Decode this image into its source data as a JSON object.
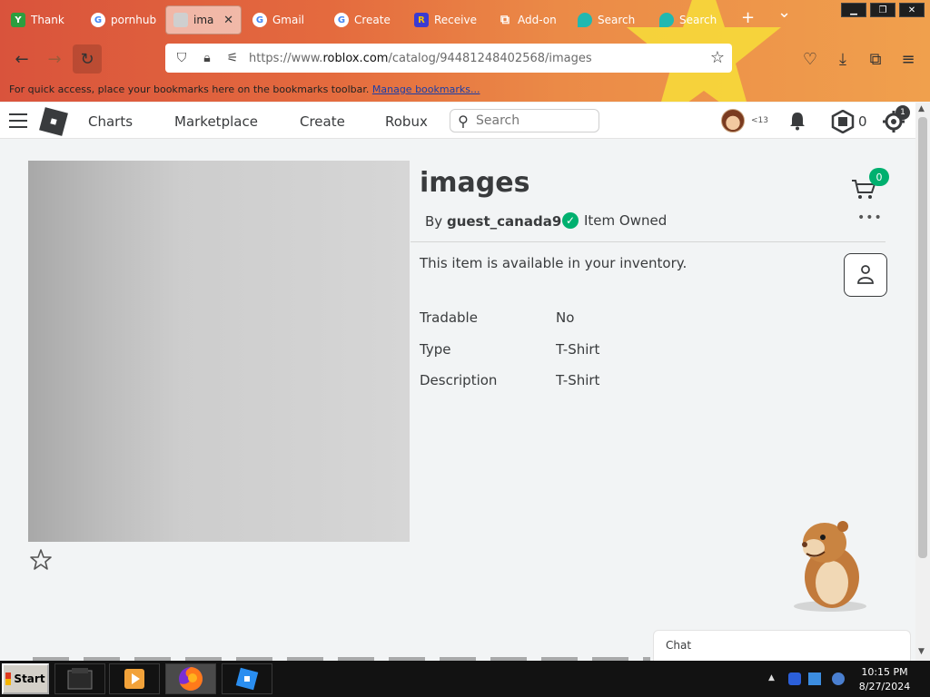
{
  "browser": {
    "tabs": [
      {
        "label": "Thank",
        "favicon": "Y",
        "favicon_color": "#2c9e3f"
      },
      {
        "label": "pornhub",
        "favicon": "G",
        "favicon_color": "#ffffff"
      },
      {
        "label": "image",
        "favicon": "img",
        "favicon_color": "#cccccc",
        "active": true
      },
      {
        "label": "Gmail",
        "favicon": "G",
        "favicon_color": "#ffffff"
      },
      {
        "label": "Create",
        "favicon": "G",
        "favicon_color": "#ffffff"
      },
      {
        "label": "Receive",
        "favicon": "R",
        "favicon_color": "#3b3bd1"
      },
      {
        "label": "Add-on",
        "favicon": "puzzle",
        "favicon_color": "#ffffff"
      },
      {
        "label": "Search",
        "favicon": "shield",
        "favicon_color": "#21b8b0"
      },
      {
        "label": "Search",
        "favicon": "shield",
        "favicon_color": "#21b8b0"
      }
    ],
    "new_tab_symbol": "+",
    "tab_list_symbol": "⌄",
    "url": {
      "prefix": "https://www.",
      "domain": "roblox.com",
      "path": "/catalog/94481248402568/images"
    },
    "bookmarks_hint": "For quick access, place your bookmarks here on the bookmarks toolbar.",
    "bookmarks_link": "Manage bookmarks..."
  },
  "roblox_header": {
    "nav": [
      "Charts",
      "Marketplace",
      "Create",
      "Robux"
    ],
    "search_placeholder": "Search",
    "age_badge": "<13",
    "robux_count": "0",
    "settings_badge": "1"
  },
  "item": {
    "title": "images",
    "by_prefix": "By",
    "creator": "guest_canada9",
    "owned_label": "Item Owned",
    "cart_count": "0",
    "more_label": "•••",
    "availability": "This item is available in your inventory.",
    "details": [
      {
        "label": "Tradable",
        "value": "No"
      },
      {
        "label": "Type",
        "value": "T-Shirt"
      },
      {
        "label": "Description",
        "value": "T-Shirt"
      }
    ]
  },
  "chat": {
    "label": "Chat"
  },
  "taskbar": {
    "start_label": "Start",
    "clock_time": "10:15 PM",
    "clock_date": "8/27/2024"
  },
  "colors": {
    "accent_green": "#00b06f",
    "roblox_text": "#393b3d"
  }
}
